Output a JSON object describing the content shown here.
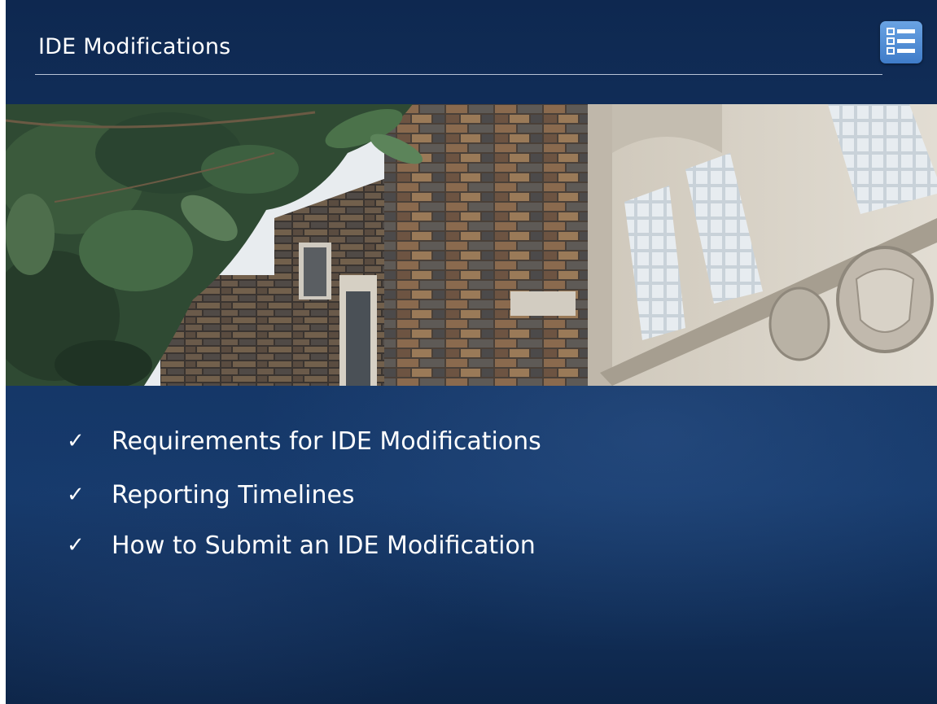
{
  "slide": {
    "title": "IDE Modifications",
    "menu_icon": "outline-menu-icon",
    "photo_description_icon": "campus-building-photo",
    "accent_color": "#4f8fd8",
    "bullet_icon": "checkmark-icon",
    "bullets": [
      "Requirements for IDE Modifications",
      "Reporting Timelines",
      "How to Submit an IDE Modification"
    ]
  }
}
